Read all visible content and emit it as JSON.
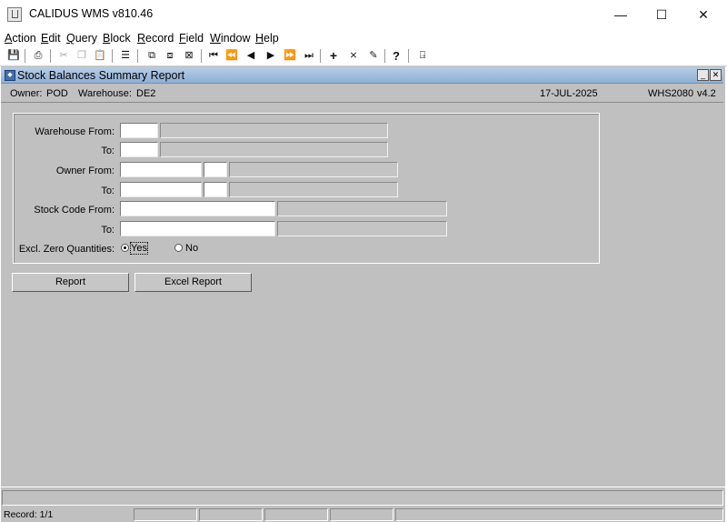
{
  "window": {
    "title": "CALIDUS WMS v810.46",
    "minimize": "—",
    "maximize": "☐",
    "close": "✕"
  },
  "menu": [
    {
      "label": "Action",
      "u": "A",
      "rest": "ction"
    },
    {
      "label": "Edit",
      "u": "E",
      "rest": "dit"
    },
    {
      "label": "Query",
      "u": "Q",
      "rest": "uery"
    },
    {
      "label": "Block",
      "u": "B",
      "rest": "lock"
    },
    {
      "label": "Record",
      "u": "R",
      "rest": "ecord"
    },
    {
      "label": "Field",
      "u": "F",
      "rest": "ield"
    },
    {
      "label": "Window",
      "u": "W",
      "rest": "indow"
    },
    {
      "label": "Help",
      "u": "H",
      "rest": "elp"
    }
  ],
  "toolbar_icons": [
    "save-icon",
    "print-icon",
    "cut-icon",
    "copy-icon",
    "paste-icon",
    "clear-field-icon",
    "enter-query-icon",
    "execute-query-icon",
    "cancel-query-icon",
    "first-record-icon",
    "previous-block-icon",
    "previous-record-icon",
    "next-record-icon",
    "next-block-icon",
    "last-record-icon",
    "insert-record-icon",
    "delete-record-icon",
    "lov-icon",
    "help-icon",
    "exit-icon"
  ],
  "form": {
    "title": "Stock Balances Summary Report",
    "minimize": "_",
    "close": "✕"
  },
  "info": {
    "owner_label": "Owner:",
    "owner_value": "POD",
    "warehouse_label": "Warehouse:",
    "warehouse_value": "DE2",
    "date": "17-JUL-2025",
    "form_code": "WHS2080",
    "version": "v4.2"
  },
  "fields": {
    "warehouse_from_label": "Warehouse From:",
    "warehouse_to_label": "To:",
    "owner_from_label": "Owner From:",
    "owner_to_label": "To:",
    "stock_from_label": "Stock Code From:",
    "stock_to_label": "To:",
    "excl_zero_label": "Excl. Zero Quantities:",
    "warehouse_from_value": "",
    "warehouse_to_value": "",
    "owner_from_value": "",
    "owner_to_value": "",
    "stock_from_value": "",
    "stock_to_value": ""
  },
  "radio": {
    "yes_label": "Yes",
    "no_label": "No",
    "selected": "yes"
  },
  "buttons": {
    "report": "Report",
    "excel_report": "Excel Report"
  },
  "status": {
    "message": "",
    "record": "Record: 1/1"
  }
}
